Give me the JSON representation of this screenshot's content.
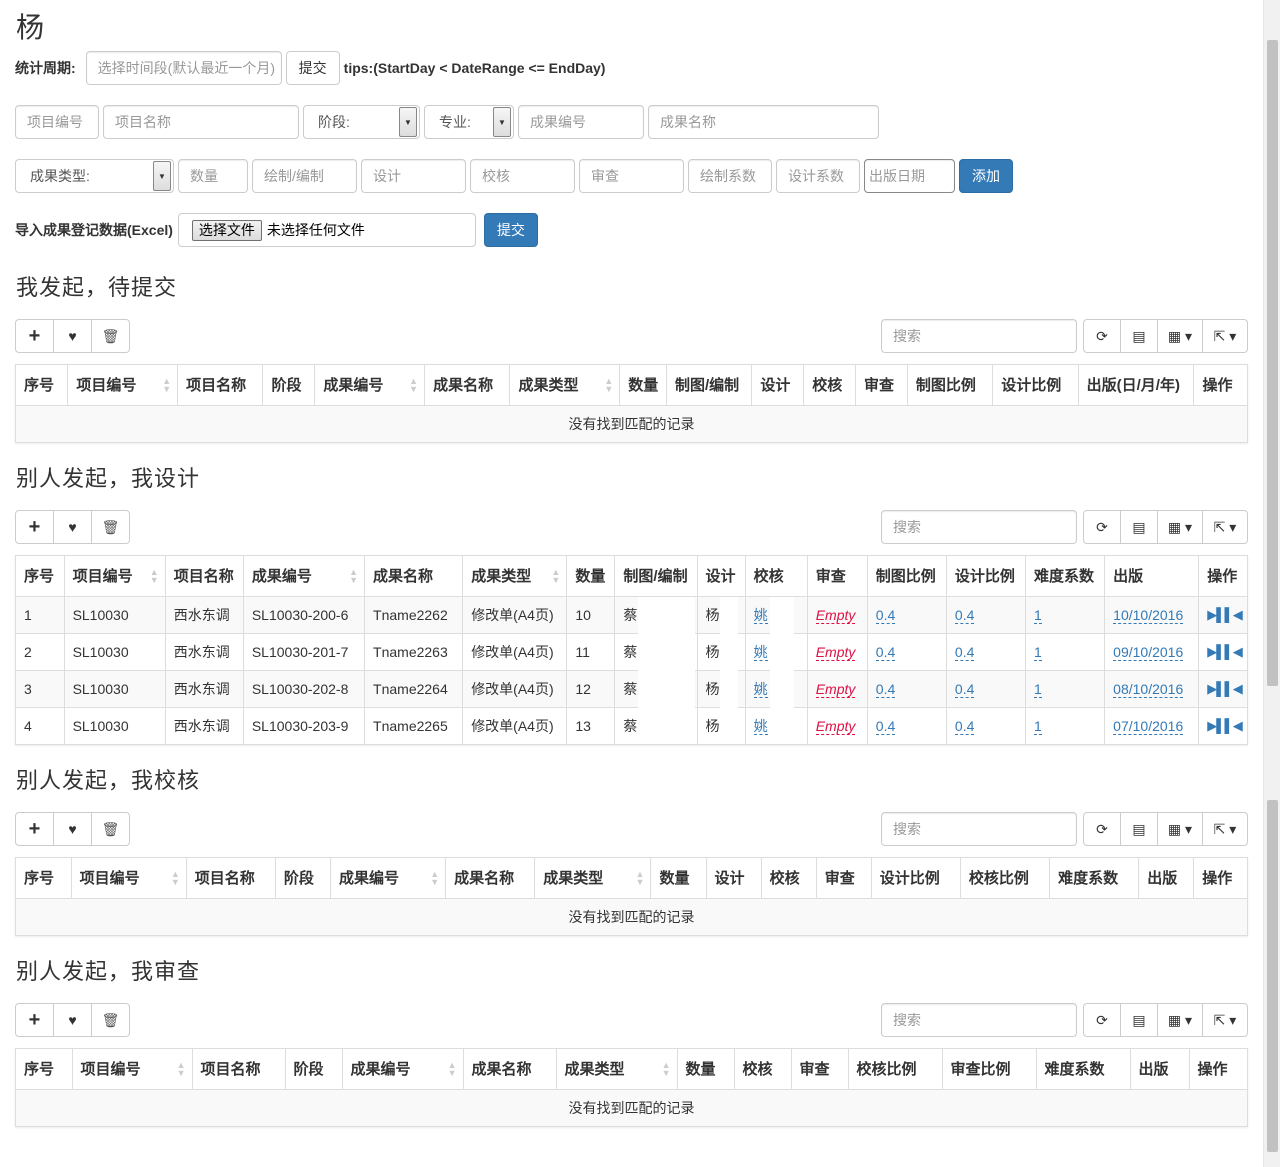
{
  "user_name": "杨",
  "period": {
    "label": "统计周期:",
    "placeholder": "选择时间段(默认最近一个月)",
    "submit": "提交",
    "tips": "tips:(StartDay < DateRange <= EndDay)"
  },
  "form1": {
    "project_no": "项目编号",
    "project_name": "项目名称",
    "stage": "阶段:",
    "major": "专业:",
    "result_no": "成果编号",
    "result_name": "成果名称"
  },
  "form2": {
    "result_type": "成果类型:",
    "quantity": "数量",
    "drawing": "绘制/编制",
    "design": "设计",
    "check": "校核",
    "review": "审查",
    "draw_coef": "绘制系数",
    "design_coef": "设计系数",
    "pub_date": "出版日期",
    "add": "添加"
  },
  "import": {
    "label": "导入成果登记数据(Excel)",
    "choose": "选择文件",
    "no_file": "未选择任何文件",
    "submit": "提交"
  },
  "search_placeholder": "搜索",
  "empty_text": "没有找到匹配的记录",
  "sections": {
    "s1": {
      "title": "我发起，待提交",
      "headers": [
        "序号",
        "项目编号",
        "项目名称",
        "阶段",
        "成果编号",
        "成果名称",
        "成果类型",
        "数量",
        "制图/编制",
        "设计",
        "校核",
        "审查",
        "制图比例",
        "设计比例",
        "出版(日/月/年)",
        "操作"
      ]
    },
    "s2": {
      "title": "别人发起，我设计",
      "headers": [
        "序号",
        "项目编号",
        "项目名称",
        "成果编号",
        "成果名称",
        "成果类型",
        "数量",
        "制图/编制",
        "设计",
        "校核",
        "审查",
        "制图比例",
        "设计比例",
        "难度系数",
        "出版",
        "操作"
      ],
      "rows": [
        {
          "idx": "1",
          "pno": "SL10030",
          "pname": "西水东调",
          "rno": "SL10030-200-6",
          "rname": "Tname2262",
          "rtype": "修改单(A4页)",
          "qty": "10",
          "draw": "蔡",
          "design": "杨",
          "check": "姚",
          "review": "Empty",
          "draw_ratio": "0.4",
          "design_ratio": "0.4",
          "difficulty": "1",
          "pub": "10/10/2016"
        },
        {
          "idx": "2",
          "pno": "SL10030",
          "pname": "西水东调",
          "rno": "SL10030-201-7",
          "rname": "Tname2263",
          "rtype": "修改单(A4页)",
          "qty": "11",
          "draw": "蔡",
          "design": "杨",
          "check": "姚",
          "review": "Empty",
          "draw_ratio": "0.4",
          "design_ratio": "0.4",
          "difficulty": "1",
          "pub": "09/10/2016"
        },
        {
          "idx": "3",
          "pno": "SL10030",
          "pname": "西水东调",
          "rno": "SL10030-202-8",
          "rname": "Tname2264",
          "rtype": "修改单(A4页)",
          "qty": "12",
          "draw": "蔡",
          "design": "杨",
          "check": "姚",
          "review": "Empty",
          "draw_ratio": "0.4",
          "design_ratio": "0.4",
          "difficulty": "1",
          "pub": "08/10/2016"
        },
        {
          "idx": "4",
          "pno": "SL10030",
          "pname": "西水东调",
          "rno": "SL10030-203-9",
          "rname": "Tname2265",
          "rtype": "修改单(A4页)",
          "qty": "13",
          "draw": "蔡",
          "design": "杨",
          "check": "姚",
          "review": "Empty",
          "draw_ratio": "0.4",
          "design_ratio": "0.4",
          "difficulty": "1",
          "pub": "07/10/2016"
        }
      ]
    },
    "s3": {
      "title": "别人发起，我校核",
      "headers": [
        "序号",
        "项目编号",
        "项目名称",
        "阶段",
        "成果编号",
        "成果名称",
        "成果类型",
        "数量",
        "设计",
        "校核",
        "审查",
        "设计比例",
        "校核比例",
        "难度系数",
        "出版",
        "操作"
      ]
    },
    "s4": {
      "title": "别人发起，我审查",
      "headers": [
        "序号",
        "项目编号",
        "项目名称",
        "阶段",
        "成果编号",
        "成果名称",
        "成果类型",
        "数量",
        "校核",
        "审查",
        "校核比例",
        "审查比例",
        "难度系数",
        "出版",
        "操作"
      ]
    }
  },
  "icons": [
    "plus-icon",
    "heart-icon",
    "trash-icon",
    "refresh-icon",
    "list-icon",
    "columns-icon",
    "export-icon"
  ],
  "colors": {
    "primary": "#337ab7",
    "empty_red": "#dd1144"
  }
}
